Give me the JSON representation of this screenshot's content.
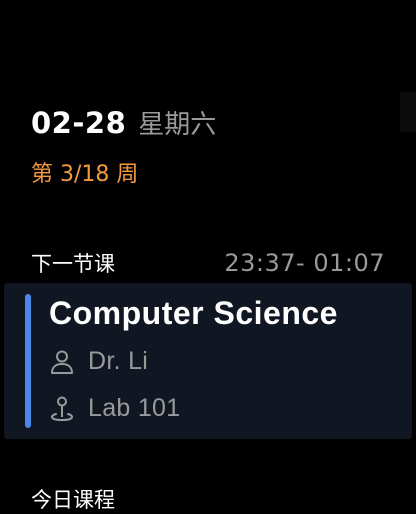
{
  "header": {
    "date": "02-28",
    "weekday": "星期六",
    "week": "第 3/18 周"
  },
  "next_class": {
    "label": "下一节课",
    "time": "23:37- 01:07",
    "course": "Computer Science",
    "teacher": "Dr. Li",
    "room": "Lab 101",
    "teacher_icon": "person-icon",
    "room_icon": "location-pin-icon",
    "accent_color": "#4f86ec"
  },
  "today": {
    "label": "今日课程"
  },
  "colors": {
    "background": "#000000",
    "card": "#101722",
    "week_accent": "#f49a3c",
    "secondary_text": "#9a9a9a"
  }
}
